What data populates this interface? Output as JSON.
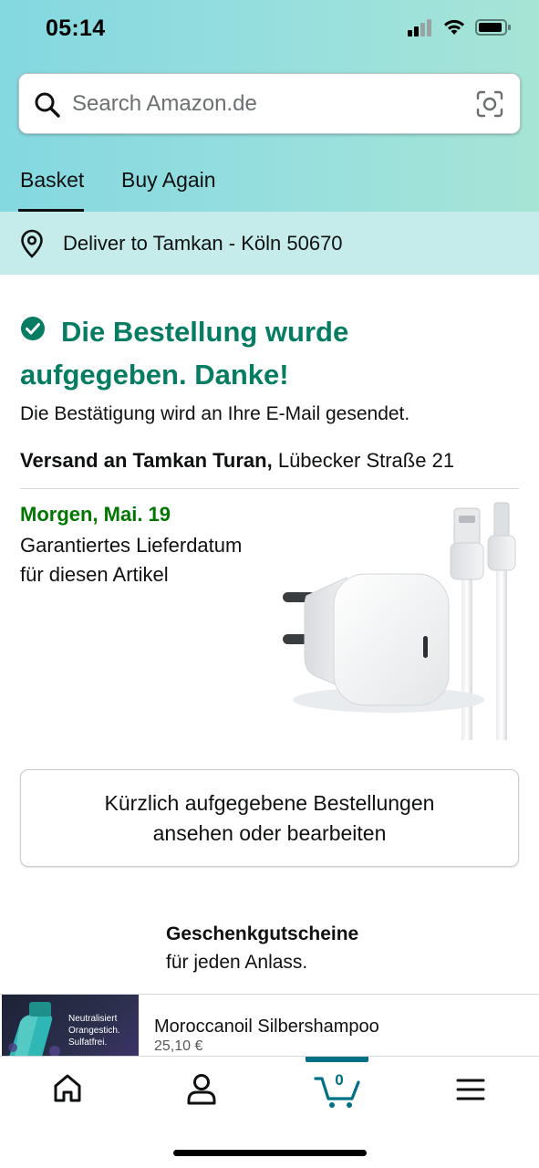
{
  "status_bar": {
    "time": "05:14"
  },
  "search": {
    "placeholder": "Search Amazon.de"
  },
  "tabs": [
    {
      "label": "Basket",
      "active": true
    },
    {
      "label": "Buy Again",
      "active": false
    }
  ],
  "delivery_bar": {
    "text": "Deliver to Tamkan - Köln 50670"
  },
  "confirmation": {
    "title": "Die Bestellung wurde aufgegeben. Danke!",
    "subtitle": "Die Bestätigung wird an Ihre E-Mail gesendet.",
    "ship_label": "Versand an Tamkan Turan,",
    "ship_address": " Lübecker Straße 21"
  },
  "delivery": {
    "date": "Morgen, Mai. 19",
    "description": "Garantiertes Lieferdatum für diesen Artikel"
  },
  "orders_button": {
    "label": "Kürzlich aufgegebene Bestellungen ansehen oder bearbeiten"
  },
  "gift": {
    "title": "Geschenkgutscheine",
    "subtitle": "für jeden Anlass."
  },
  "ad": {
    "image_text": "Neutralisiert Orangestich. Sulfatfrei.",
    "title": "Moroccanoil Silbershampoo",
    "price": "25,10 €"
  },
  "bottom_nav": {
    "cart_count": "0",
    "items": [
      "home-icon",
      "account-icon",
      "cart-icon",
      "menu-icon"
    ]
  },
  "colors": {
    "success_green": "#067d62",
    "date_green": "#007600",
    "nav_accent": "#007185"
  }
}
